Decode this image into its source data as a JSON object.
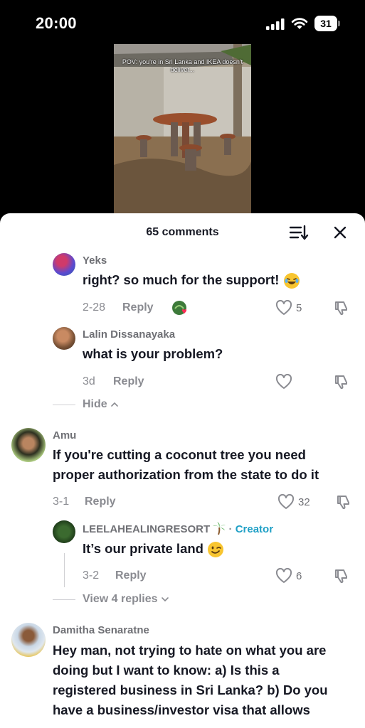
{
  "status_bar": {
    "time": "20:00",
    "battery": "31"
  },
  "video": {
    "caption": "POV: you're in Sri Lanka and IKEA doesn't deliver..."
  },
  "sheet": {
    "title": "65 comments"
  },
  "comments": [
    {
      "user": "Yeks",
      "text": "right? so much for the support!",
      "date": "2-28",
      "reply": "Reply",
      "likes": "5"
    },
    {
      "user": "Lalin Dissanayaka",
      "text": "what is your problem?",
      "date": "3d",
      "reply": "Reply",
      "likes": ""
    },
    {
      "user": "Amu",
      "text_line1": "If you're cutting a coconut tree you need",
      "text_line2": "proper authorization from the state to do it",
      "date": "3-1",
      "reply": "Reply",
      "likes": "32"
    },
    {
      "user": "LEELAHEALINGRESORT",
      "badge": "Creator",
      "text": "It’s our private land",
      "date": "3-2",
      "reply": "Reply",
      "likes": "6"
    },
    {
      "user": "Damitha Senaratne",
      "text_line1": "Hey man, not trying to hate on what you are",
      "text_line2": "doing but I want to know: a) Is this a",
      "text_line3": "registered business in Sri Lanka? b) Do you",
      "text_line4": "have a business/investor visa that allows"
    }
  ],
  "links": {
    "hide": "Hide",
    "view_replies": "View 4 replies"
  },
  "colors": {
    "creator": "#20a0c6",
    "sheet_bg": "#ffffff",
    "meta": "#8a8b91"
  },
  "icons": [
    "signal-icon",
    "wifi-icon",
    "battery-icon",
    "sort-icon",
    "close-icon",
    "heart-icon",
    "dislike-icon",
    "chevron-up-icon",
    "chevron-down-icon"
  ]
}
